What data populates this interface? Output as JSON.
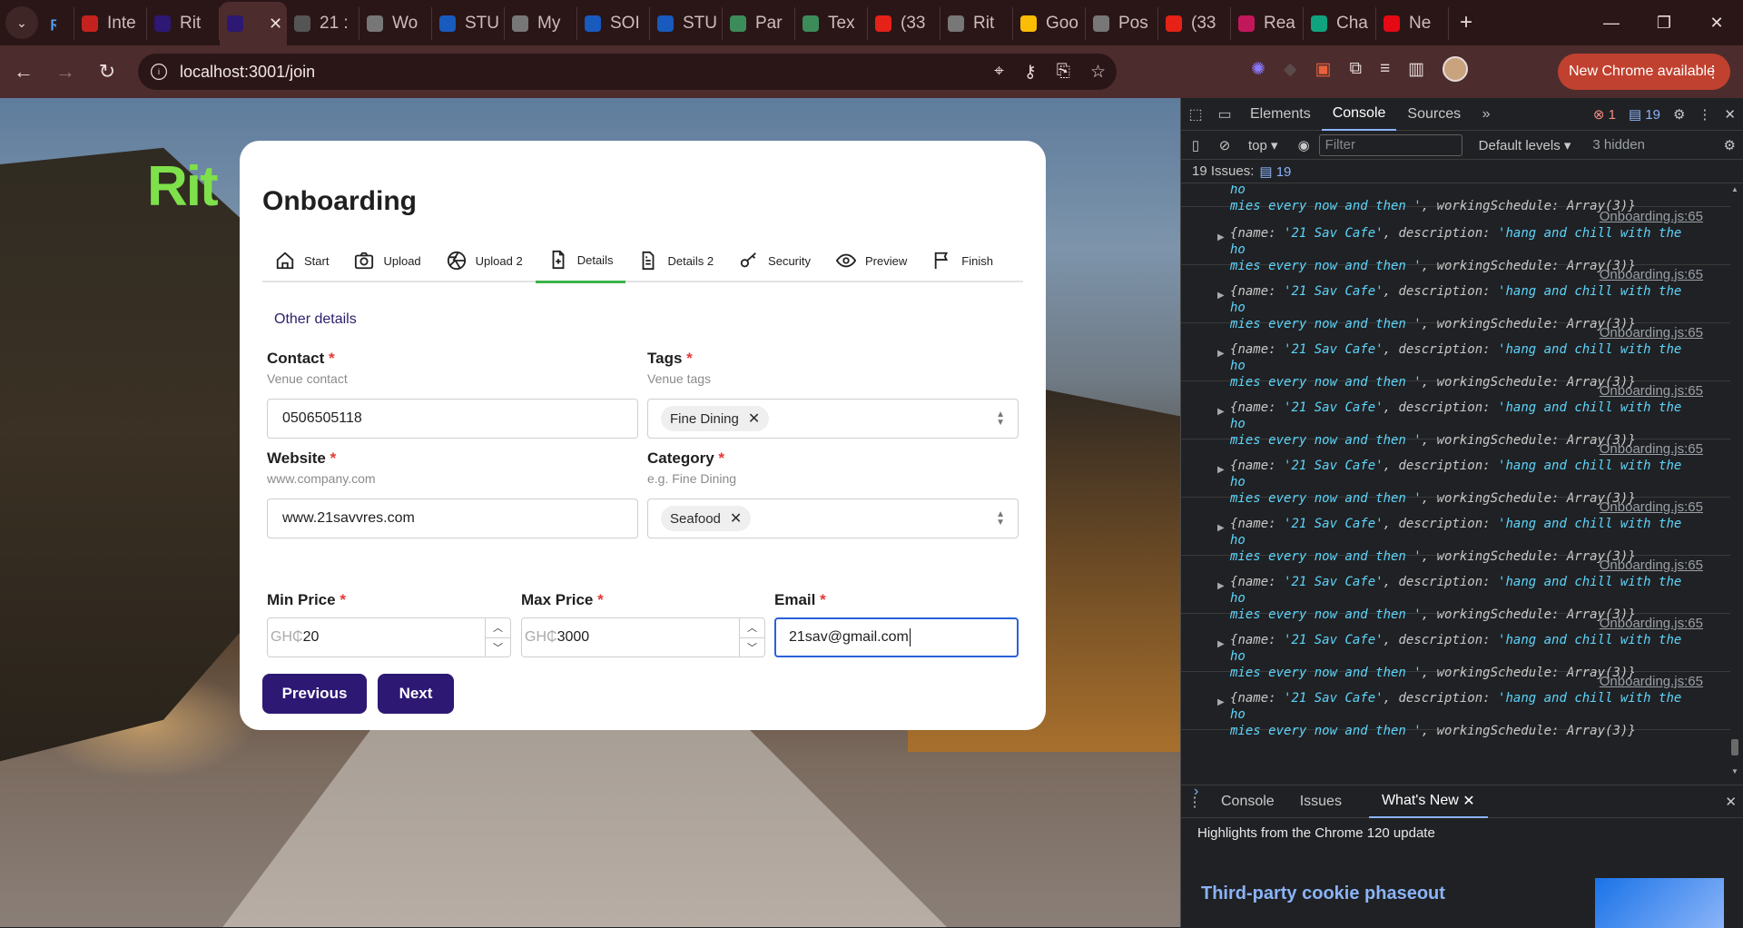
{
  "browser": {
    "tabs": [
      {
        "label": "Inte",
        "color": "#c5221f"
      },
      {
        "label": "Rit",
        "color": "#2d1874"
      },
      {
        "label": "",
        "color": "#2d1874",
        "active": true
      },
      {
        "label": "21 :",
        "color": "#555"
      },
      {
        "label": "Wo",
        "color": "#777"
      },
      {
        "label": "STU",
        "color": "#185abd"
      },
      {
        "label": "My",
        "color": "#777"
      },
      {
        "label": "SOI",
        "color": "#185abd"
      },
      {
        "label": "STU",
        "color": "#185abd"
      },
      {
        "label": "Par",
        "color": "#3c8c5a"
      },
      {
        "label": "Tex",
        "color": "#3c8c5a"
      },
      {
        "label": "(33",
        "color": "#e62117"
      },
      {
        "label": "Rit",
        "color": "#777"
      },
      {
        "label": "Goo",
        "color": "#fbbc04"
      },
      {
        "label": "Pos",
        "color": "#777"
      },
      {
        "label": "(33",
        "color": "#e62117"
      },
      {
        "label": "Rea",
        "color": "#c2185b"
      },
      {
        "label": "Cha",
        "color": "#10a37f"
      },
      {
        "label": "Ne",
        "color": "#e50914"
      }
    ],
    "url": "localhost:3001/join",
    "update_label": "New Chrome available"
  },
  "app": {
    "logo": "Rit",
    "title": "Onboarding",
    "steps": [
      "Start",
      "Upload",
      "Upload 2",
      "Details",
      "Details 2",
      "Security",
      "Preview",
      "Finish"
    ],
    "active_step": "Details",
    "section": "Other details",
    "contact": {
      "label": "Contact",
      "hint": "Venue contact",
      "value": "0506505118"
    },
    "tags": {
      "label": "Tags",
      "hint": "Venue tags",
      "chip": "Fine Dining"
    },
    "website": {
      "label": "Website",
      "hint": "www.company.com",
      "value": "www.21savvres.com"
    },
    "category": {
      "label": "Category",
      "hint": "e.g. Fine Dining",
      "chip": "Seafood"
    },
    "min_price": {
      "label": "Min Price",
      "prefix": "GH₵",
      "value": "20"
    },
    "max_price": {
      "label": "Max Price",
      "prefix": "GH₵",
      "value": "3000"
    },
    "email": {
      "label": "Email",
      "value": "21sav@gmail.com"
    },
    "required_mark": "*",
    "prev_label": "Previous",
    "next_label": "Next"
  },
  "devtools": {
    "tabs": [
      "Elements",
      "Console",
      "Sources"
    ],
    "active_tab": "Console",
    "error_count": "1",
    "message_count": "19",
    "context": "top",
    "filter_placeholder": "Filter",
    "levels": "Default levels",
    "hidden": "3 hidden",
    "issues_label": "19 Issues:",
    "issues_count": "19",
    "source": "Onboarding.js:65",
    "log_line1_name": "'21 Sav Cafe'",
    "log_line1_desc": "'hang and chill with the ho",
    "log_line2": "mies every now and then '",
    "log_schedule": "Array(3)",
    "entry_count": 10,
    "drawer_tabs": [
      "Console",
      "Issues",
      "What's New"
    ],
    "drawer_active": "What's New",
    "highlights": "Highlights from the Chrome 120 update",
    "cookie_title": "Third-party cookie phaseout"
  }
}
